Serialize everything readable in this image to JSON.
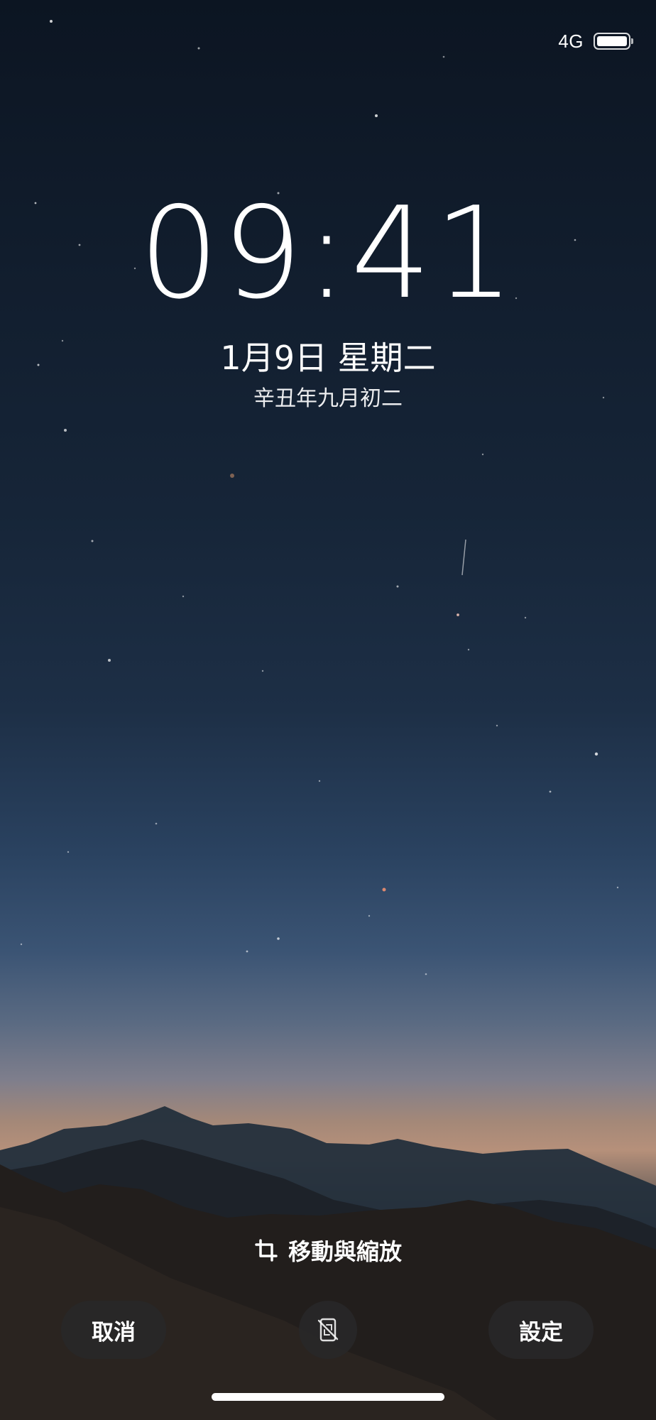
{
  "status_bar": {
    "network": "4G",
    "battery_level": 1.0
  },
  "lock_screen": {
    "time": "09:41",
    "date": "1月9日 星期二",
    "lunar_date": "辛丑年九月初二"
  },
  "editor": {
    "move_zoom_label": "移動與縮放",
    "cancel_label": "取消",
    "set_label": "設定",
    "crop_icon": "crop-icon",
    "rotate_icon": "rotate-phone-icon"
  },
  "colors": {
    "text": "#ffffff",
    "button_bg": "#28282a"
  }
}
